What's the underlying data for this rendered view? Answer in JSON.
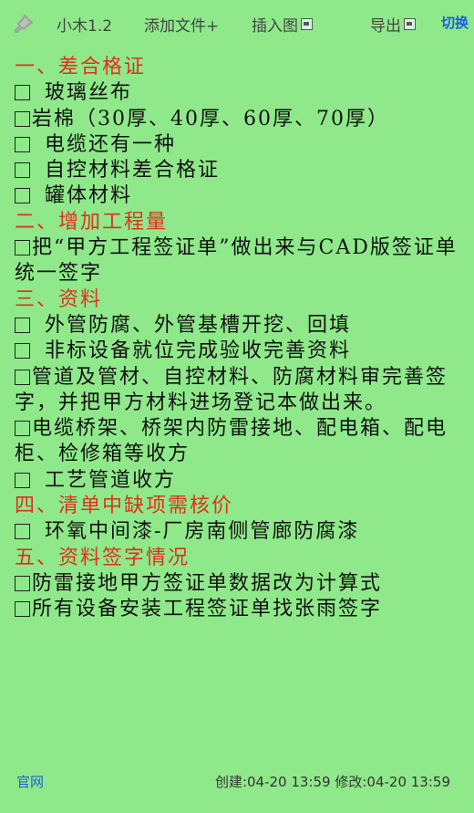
{
  "toolbar": {
    "title": "小木1.2",
    "add_file": "添加文件+",
    "insert_image": "插入图",
    "export": "导出",
    "mode": "切换"
  },
  "sections": [
    {
      "heading": "一、差合格证",
      "items": [
        {
          "text": "玻璃丝布",
          "gap": true
        },
        {
          "text": "岩棉（30厚、40厚、60厚、70厚）",
          "gap": false
        },
        {
          "text": "电缆还有一种",
          "gap": true
        },
        {
          "text": "自控材料差合格证",
          "gap": true
        },
        {
          "text": "罐体材料",
          "gap": true
        }
      ]
    },
    {
      "heading": "二、增加工程量",
      "items": [
        {
          "text": "把“甲方工程签证单”做出来与CAD版签证单统一签字",
          "gap": false
        }
      ]
    },
    {
      "heading": "三、资料",
      "items": [
        {
          "text": "外管防腐、外管基槽开挖、回填",
          "gap": true
        },
        {
          "text": "非标设备就位完成验收完善资料",
          "gap": true
        },
        {
          "text": "管道及管材、自控材料、防腐材料审完善签字，并把甲方材料进场登记本做出来。",
          "gap": false
        },
        {
          "text": "电缆桥架、桥架内防雷接地、配电箱、配电柜、检修箱等收方",
          "gap": false
        },
        {
          "text": "工艺管道收方",
          "gap": true
        }
      ]
    },
    {
      "heading": "四、清单中缺项需核价",
      "items": [
        {
          "text": "环氧中间漆-厂房南侧管廊防腐漆",
          "gap": true
        }
      ]
    },
    {
      "heading": "五、资料签字情况",
      "items": [
        {
          "text": "防雷接地甲方签证单数据改为计算式",
          "gap": false
        },
        {
          "text": "所有设备安装工程签证单找张雨签字",
          "gap": false
        }
      ]
    }
  ],
  "footer": {
    "link": "官网",
    "meta": "创建:04-20 13:59 修改:04-20 13:59"
  },
  "colors": {
    "background": "#8fe98a",
    "heading": "#e0301b",
    "link": "#1a5fd8"
  }
}
